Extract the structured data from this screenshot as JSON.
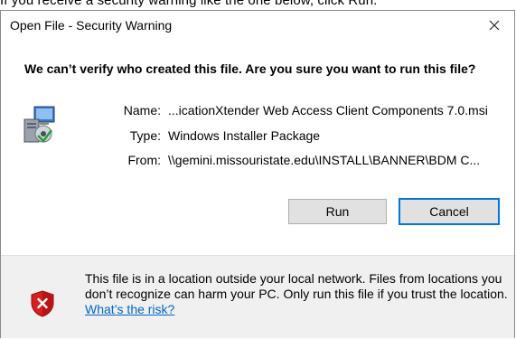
{
  "background_text": "If you receive a security warning like the one below, click Run.",
  "dialog": {
    "title": "Open File - Security Warning",
    "close_glyph": "✕",
    "headline": "We can’t verify who created this file. Are you sure you want to run this file?",
    "fields": [
      {
        "label": "Name:",
        "value": "...icationXtender Web Access Client Components 7.0.msi"
      },
      {
        "label": "Type:",
        "value": "Windows Installer Package"
      },
      {
        "label": "From:",
        "value": "\\\\gemini.missouristate.edu\\INSTALL\\BANNER\\BDM C..."
      }
    ],
    "buttons": {
      "run": "Run",
      "cancel": "Cancel"
    },
    "warning": {
      "text": "This file is in a location outside your local network. Files from locations you don’t recognize can harm your PC. Only run this file if you trust the location.",
      "link": "What’s the risk?"
    }
  },
  "colors": {
    "accent": "#0078d7",
    "link": "#0066cc",
    "footer_bg": "#f0f0f0",
    "shield_red": "#d81e1e"
  }
}
